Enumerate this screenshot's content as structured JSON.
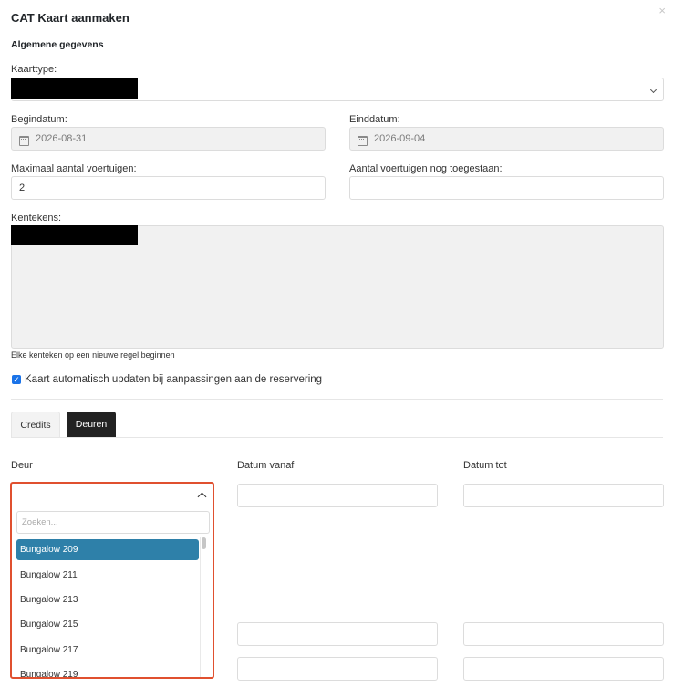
{
  "dialog": {
    "title": "CAT Kaart aanmaken",
    "section_title": "Algemene gegevens"
  },
  "form": {
    "kaarttype": {
      "label": "Kaarttype:"
    },
    "begindatum": {
      "label": "Begindatum:",
      "value": "2026-08-31"
    },
    "einddatum": {
      "label": "Einddatum:",
      "value": "2026-09-04"
    },
    "max_voertuigen": {
      "label": "Maximaal aantal voertuigen:",
      "value": "2"
    },
    "nog_toegestaan": {
      "label": "Aantal voertuigen nog toegestaan:",
      "value": ""
    },
    "kentekens": {
      "label": "Kentekens:",
      "hint": "Elke kenteken op een nieuwe regel beginnen"
    },
    "auto_update": {
      "label": "Kaart automatisch updaten bij aanpassingen aan de reservering",
      "checked": true
    }
  },
  "tabs": [
    {
      "label": "Credits",
      "active": false
    },
    {
      "label": "Deuren",
      "active": true
    }
  ],
  "doors": {
    "headers": {
      "deur": "Deur",
      "vanaf": "Datum vanaf",
      "tot": "Datum tot"
    },
    "dropdown": {
      "search_placeholder": "Zoeken...",
      "options": [
        "Bungalow 209",
        "Bungalow 211",
        "Bungalow 213",
        "Bungalow 215",
        "Bungalow 217",
        "Bungalow 219"
      ],
      "selected_index": 0
    }
  },
  "colors": {
    "selected_option": "#2e80a9",
    "highlight_border": "#e0502f",
    "active_tab": "#222222",
    "checkbox": "#1a73e8"
  }
}
